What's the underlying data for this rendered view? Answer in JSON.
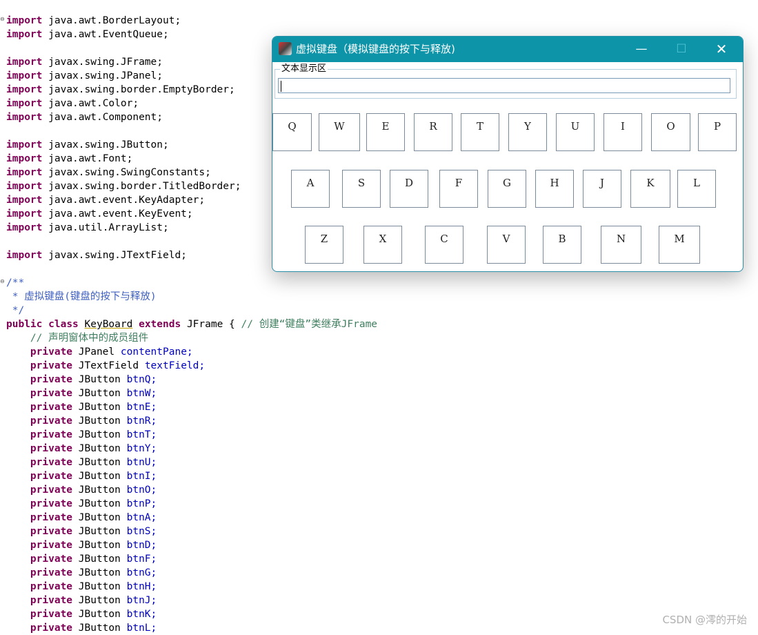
{
  "code": {
    "imports1": [
      "java.awt.BorderLayout;",
      "java.awt.EventQueue;"
    ],
    "imports2": [
      "javax.swing.JFrame;",
      "javax.swing.JPanel;",
      "javax.swing.border.EmptyBorder;",
      "java.awt.Color;",
      "java.awt.Component;"
    ],
    "imports3": [
      "javax.swing.JButton;",
      "java.awt.Font;",
      "javax.swing.SwingConstants;",
      "javax.swing.border.TitledBorder;",
      "java.awt.event.KeyAdapter;",
      "java.awt.event.KeyEvent;",
      "java.util.ArrayList;"
    ],
    "imports4": [
      "javax.swing.JTextField;"
    ],
    "import_kw": "import",
    "doc_open": "/**",
    "doc_line": " * 虚拟键盘(键盘的按下与释放)",
    "doc_close": " */",
    "class_decl": {
      "kw1": "public",
      "kw2": "class",
      "name": "KeyBoard",
      "kw3": "extends",
      "rest": "JFrame {",
      "comment": "// 创建“键盘”类继承JFrame"
    },
    "member_comment": "    // 声明窗体中的成员组件",
    "fields": [
      {
        "kw": "private",
        "type": "JPanel",
        "name": "contentPane;"
      },
      {
        "kw": "private",
        "type": "JTextField",
        "name": "textField;"
      },
      {
        "kw": "private",
        "type": "JButton",
        "name": "btnQ;"
      },
      {
        "kw": "private",
        "type": "JButton",
        "name": "btnW;"
      },
      {
        "kw": "private",
        "type": "JButton",
        "name": "btnE;"
      },
      {
        "kw": "private",
        "type": "JButton",
        "name": "btnR;"
      },
      {
        "kw": "private",
        "type": "JButton",
        "name": "btnT;"
      },
      {
        "kw": "private",
        "type": "JButton",
        "name": "btnY;"
      },
      {
        "kw": "private",
        "type": "JButton",
        "name": "btnU;"
      },
      {
        "kw": "private",
        "type": "JButton",
        "name": "btnI;"
      },
      {
        "kw": "private",
        "type": "JButton",
        "name": "btnO;"
      },
      {
        "kw": "private",
        "type": "JButton",
        "name": "btnP;"
      },
      {
        "kw": "private",
        "type": "JButton",
        "name": "btnA;"
      },
      {
        "kw": "private",
        "type": "JButton",
        "name": "btnS;"
      },
      {
        "kw": "private",
        "type": "JButton",
        "name": "btnD;"
      },
      {
        "kw": "private",
        "type": "JButton",
        "name": "btnF;"
      },
      {
        "kw": "private",
        "type": "JButton",
        "name": "btnG;"
      },
      {
        "kw": "private",
        "type": "JButton",
        "name": "btnH;"
      },
      {
        "kw": "private",
        "type": "JButton",
        "name": "btnJ;"
      },
      {
        "kw": "private",
        "type": "JButton",
        "name": "btnK;"
      },
      {
        "kw": "private",
        "type": "JButton",
        "name": "btnL;"
      }
    ]
  },
  "window": {
    "title": "虚拟键盘（模拟键盘的按下与释放)",
    "min_glyph": "—",
    "max_glyph": "☐",
    "close_glyph": "✕",
    "legend": "文本显示区",
    "text_value": "",
    "keys_row1": [
      "Q",
      "W",
      "E",
      "R",
      "T",
      "Y",
      "U",
      "I",
      "O",
      "P"
    ],
    "keys_row2": [
      "A",
      "S",
      "D",
      "F",
      "G",
      "H",
      "J",
      "K",
      "L"
    ],
    "keys_row3": [
      "Z",
      "X",
      "C",
      "V",
      "B",
      "N",
      "M"
    ],
    "titlebar_color": "#0e94a8"
  },
  "watermark": "CSDN @澪的开始"
}
